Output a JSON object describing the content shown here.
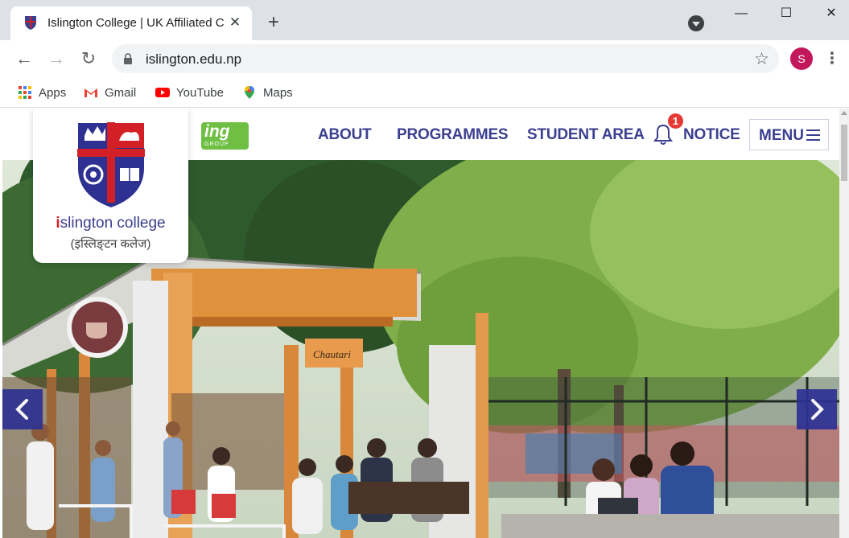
{
  "browser": {
    "tab": {
      "title": "Islington College | UK Affiliated C",
      "close": "✕"
    },
    "new_tab": "+",
    "window_controls": {
      "minimize": "—",
      "maximize": "☐",
      "close": "✕"
    },
    "nav": {
      "back": "←",
      "forward": "→",
      "reload": "↻"
    },
    "url": "islington.edu.np",
    "star": "☆",
    "profile_initial": "S",
    "menu": "⋮",
    "bookmarks": [
      {
        "label": "Apps",
        "icon": "apps-grid-icon"
      },
      {
        "label": "Gmail",
        "icon": "gmail-icon"
      },
      {
        "label": "YouTube",
        "icon": "youtube-icon"
      },
      {
        "label": "Maps",
        "icon": "maps-pin-icon"
      }
    ]
  },
  "site": {
    "logo": {
      "name_prefix": "i",
      "name_rest": "slington college",
      "name_nepali": "(इस्लिङ्टन कलेज)"
    },
    "partner_logo": {
      "text": "ing",
      "sub": "GROUP"
    },
    "nav": {
      "about": "ABOUT",
      "programmes": "PROGRAMMES",
      "student_area": "STUDENT AREA",
      "notice": "NOTICE",
      "notice_count": "1",
      "menu": "MENU"
    },
    "hero": {
      "sign_text": "Chautari",
      "prev": "‹",
      "next": "›"
    },
    "colors": {
      "brand_navy": "#3b3f8f",
      "accent_red": "#d32027",
      "partner_green": "#6fbf44"
    }
  }
}
